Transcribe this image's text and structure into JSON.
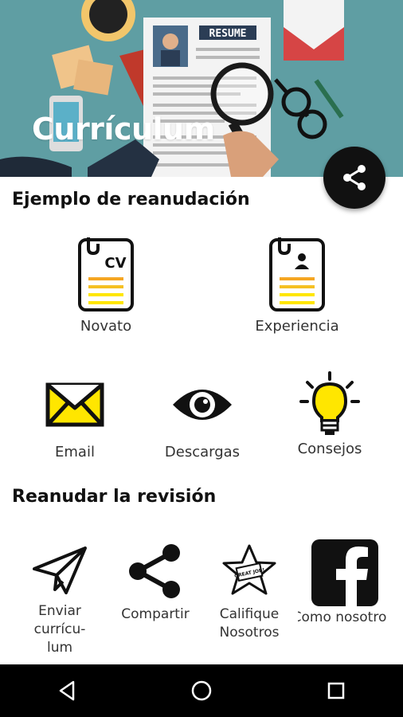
{
  "header": {
    "title": "Currículum",
    "resume_stamp": "RESUME"
  },
  "sections": {
    "examples": {
      "title": "Ejemplo de reanudación",
      "items": [
        {
          "label": "Novato",
          "icon": "cv-document-icon"
        },
        {
          "label": "Experiencia",
          "icon": "profile-document-icon"
        },
        {
          "label": "Email",
          "icon": "envelope-icon"
        },
        {
          "label": "Descargas",
          "icon": "eye-icon"
        },
        {
          "label": "Consejos",
          "icon": "lightbulb-icon"
        }
      ]
    },
    "review": {
      "title": "Reanudar la revisión",
      "items": [
        {
          "label": "Enviar currículum",
          "label_lines": [
            "Enviar",
            "currícu-",
            "lum"
          ],
          "icon": "paper-plane-icon"
        },
        {
          "label": "Compartir",
          "icon": "share-icon"
        },
        {
          "label": "Califique Nosotros",
          "label_lines": [
            "Califique",
            "Nosotros"
          ],
          "icon": "star-badge-icon"
        },
        {
          "label": "Como nosotros",
          "visible_label": "Como nosotro",
          "icon": "facebook-icon"
        }
      ]
    }
  },
  "cv_icon_text": "CV",
  "badge_text": "GREAT JOB!",
  "navbar": {
    "back": "back-icon",
    "home": "home-icon",
    "recents": "recents-icon"
  },
  "colors": {
    "header_teal": "#5f9ea3",
    "accent_yellow": "#ffe600",
    "accent_orange": "#f5a623",
    "black": "#111111"
  }
}
